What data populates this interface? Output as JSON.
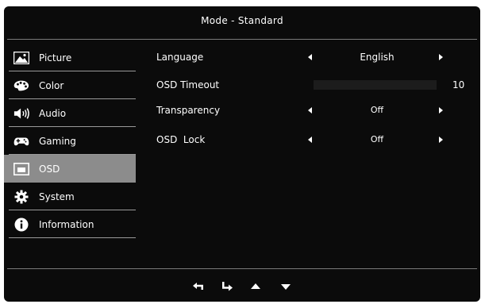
{
  "title": "Mode - Standard",
  "sidebar": {
    "items": [
      {
        "label": "Picture",
        "icon": "picture-icon"
      },
      {
        "label": "Color",
        "icon": "palette-icon"
      },
      {
        "label": "Audio",
        "icon": "speaker-icon"
      },
      {
        "label": "Gaming",
        "icon": "gamepad-icon"
      },
      {
        "label": "OSD",
        "icon": "osd-icon",
        "selected": true
      },
      {
        "label": "System",
        "icon": "gear-icon"
      },
      {
        "label": "Information",
        "icon": "info-icon"
      }
    ]
  },
  "settings": {
    "language": {
      "label": "Language",
      "value": "English"
    },
    "osd_timeout": {
      "label": "OSD Timeout",
      "value": "10"
    },
    "transparency": {
      "label": "Transparency",
      "value": "Off"
    },
    "osd_lock": {
      "label": "OSD  Lock",
      "value": "Off"
    }
  },
  "nav": {
    "buttons": [
      "back-icon",
      "enter-icon",
      "up-icon",
      "down-icon"
    ]
  },
  "colors": {
    "background": "#0b0b0b",
    "selected": "#8c8c8c",
    "text": "#ffffff",
    "separator": "#9a9a9a"
  }
}
